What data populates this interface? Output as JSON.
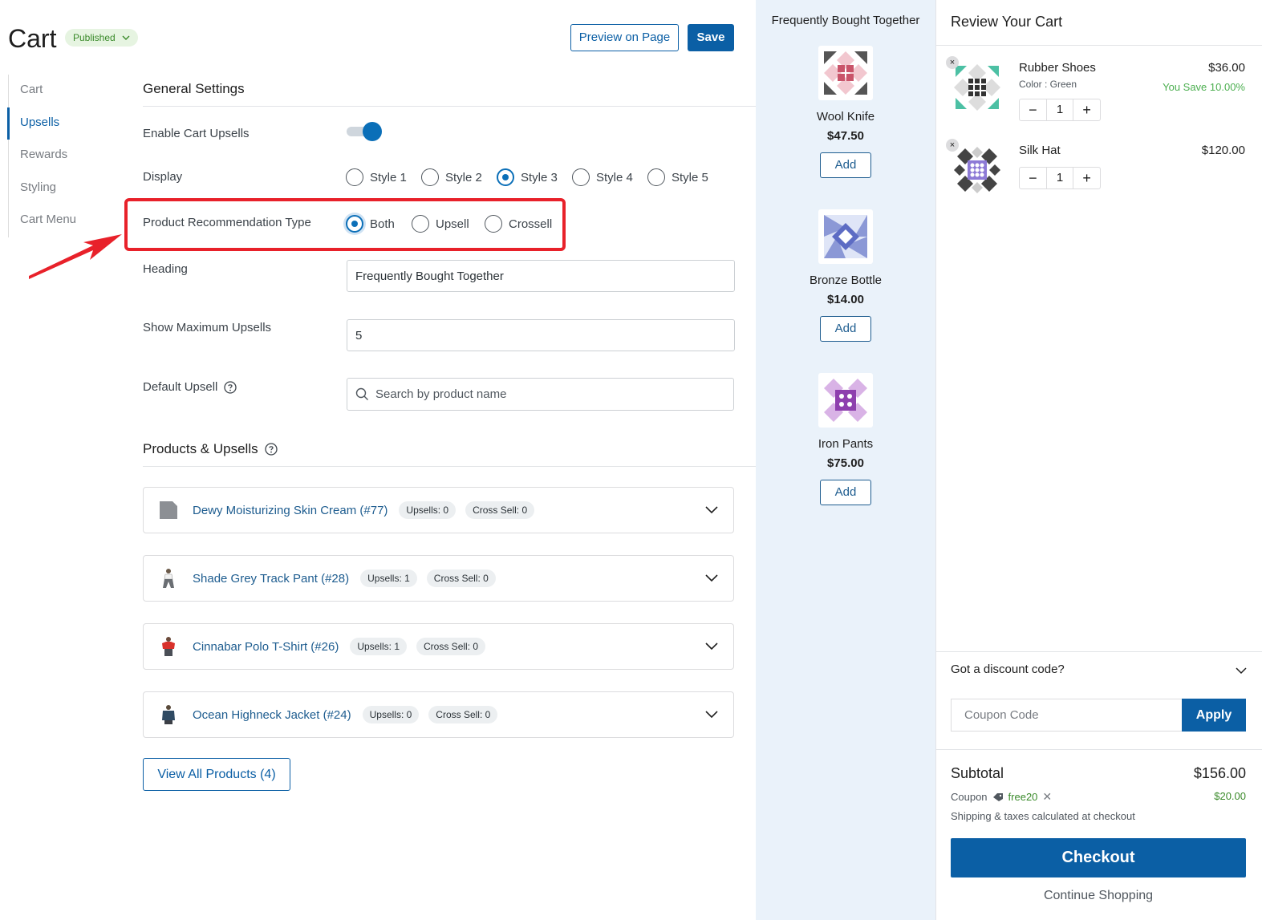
{
  "header": {
    "title": "Cart",
    "status": "Published",
    "preview_label": "Preview on Page",
    "save_label": "Save"
  },
  "nav": {
    "items": [
      {
        "label": "Cart"
      },
      {
        "label": "Upsells"
      },
      {
        "label": "Rewards"
      },
      {
        "label": "Styling"
      },
      {
        "label": "Cart Menu"
      }
    ],
    "active": "Upsells"
  },
  "general": {
    "title": "General Settings",
    "enable_label": "Enable Cart Upsells",
    "enable_on": true,
    "display_label": "Display",
    "display_options": [
      "Style 1",
      "Style 2",
      "Style 3",
      "Style 4",
      "Style 5"
    ],
    "display_selected": "Style 3",
    "rec_type_label": "Product Recommendation Type",
    "rec_type_options": [
      "Both",
      "Upsell",
      "Crossell"
    ],
    "rec_type_selected": "Both",
    "heading_label": "Heading",
    "heading_value": "Frequently Bought Together",
    "max_label": "Show Maximum Upsells",
    "max_value": "5",
    "default_label": "Default Upsell",
    "default_placeholder": "Search by product name"
  },
  "products": {
    "title": "Products & Upsells",
    "rows": [
      {
        "name": "Dewy Moisturizing Skin Cream (#77)",
        "upsells": "Upsells: 0",
        "cross": "Cross Sell: 0"
      },
      {
        "name": "Shade Grey Track Pant (#28)",
        "upsells": "Upsells: 1",
        "cross": "Cross Sell: 0"
      },
      {
        "name": "Cinnabar Polo T-Shirt (#26)",
        "upsells": "Upsells: 1",
        "cross": "Cross Sell: 0"
      },
      {
        "name": "Ocean Highneck Jacket (#24)",
        "upsells": "Upsells: 0",
        "cross": "Cross Sell: 0"
      }
    ],
    "view_all_label": "View All Products (4)"
  },
  "upsell_panel": {
    "heading": "Frequently Bought Together",
    "items": [
      {
        "name": "Wool Knife",
        "price": "$47.50",
        "add_label": "Add"
      },
      {
        "name": "Bronze Bottle",
        "price": "$14.00",
        "add_label": "Add"
      },
      {
        "name": "Iron Pants",
        "price": "$75.00",
        "add_label": "Add"
      }
    ]
  },
  "cart": {
    "title": "Review Your Cart",
    "items": [
      {
        "name": "Rubber Shoes",
        "variant": "Color : Green",
        "price": "$36.00",
        "save": "You Save 10.00%",
        "qty": "1"
      },
      {
        "name": "Silk Hat",
        "price": "$120.00",
        "qty": "1"
      }
    ],
    "remove_glyph": "×",
    "qty_minus": "−",
    "qty_plus": "+",
    "discount_label": "Got a discount code?",
    "coupon_placeholder": "Coupon Code",
    "apply_label": "Apply",
    "subtotal_label": "Subtotal",
    "subtotal_value": "$156.00",
    "coupon_label": "Coupon",
    "coupon_code": "free20",
    "coupon_remove": "✕",
    "coupon_amount": "$20.00",
    "shipping_note": "Shipping & taxes calculated at checkout",
    "checkout_label": "Checkout",
    "continue_label": "Continue Shopping"
  },
  "colors": {
    "accent": "#0b5fa5",
    "highlight": "#e8212a",
    "success": "#3a8a2a",
    "panel_bg": "#eaf2fa"
  },
  "icons": [
    "chevron-down-icon",
    "help-icon",
    "search-icon",
    "toggle-switch",
    "red-arrow",
    "close-icon",
    "tag-icon"
  ]
}
